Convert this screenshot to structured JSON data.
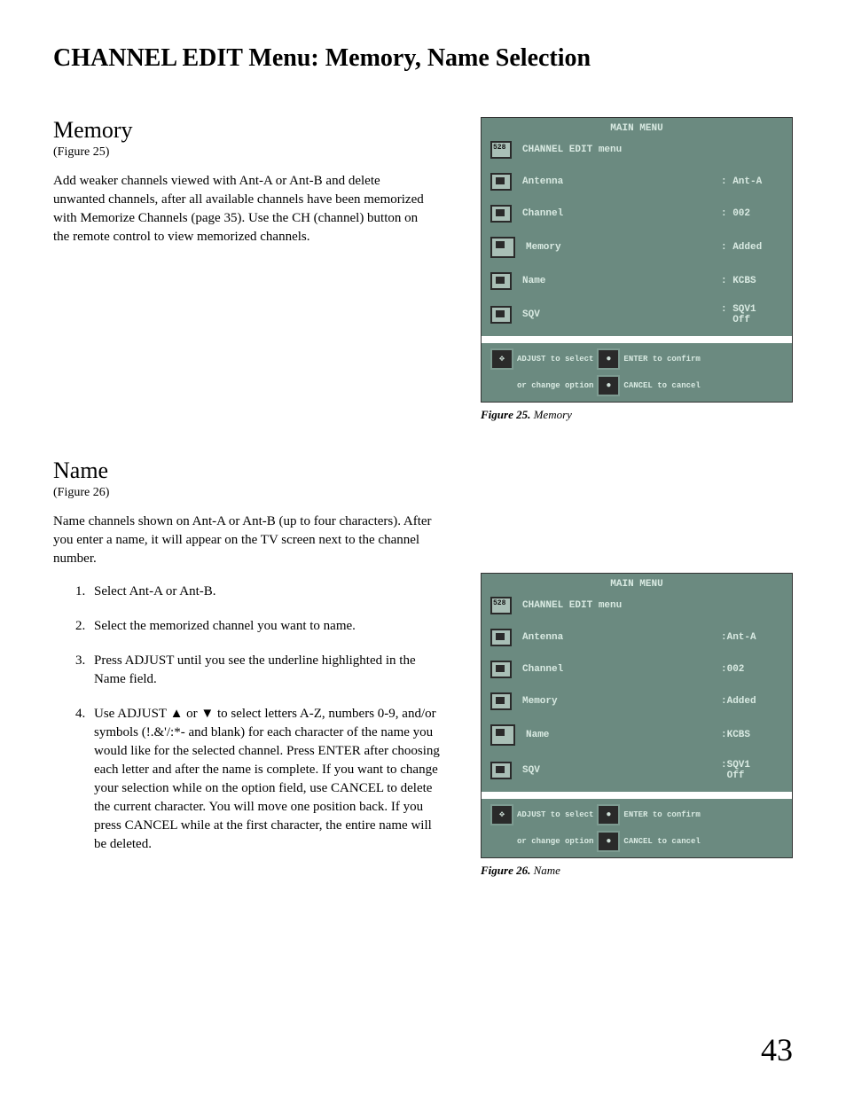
{
  "page": {
    "title": "CHANNEL EDIT Menu: Memory, Name Selection",
    "number": "43"
  },
  "memory": {
    "heading": "Memory",
    "figref": "(Figure 25)",
    "body": "Add weaker channels viewed with Ant-A or Ant-B and delete unwanted channels, after all available channels have been memorized with Memorize Channels (page 35).  Use the CH (channel) button on the remote control to view memorized channels."
  },
  "name": {
    "heading": "Name",
    "figref": "(Figure 26)",
    "body": "Name channels shown on Ant-A or Ant-B (up to four characters).  After you enter a name, it will appear on the TV screen next to the channel number.",
    "steps": [
      "Select Ant-A or Ant-B.",
      "Select the memorized channel you want to name.",
      "Press ADJUST until you see the underline highlighted in the Name field.",
      "Use ADJUST ▲ or ▼ to select letters A-Z, numbers 0-9, and/or symbols (!.&'/:*- and blank) for each character of the name you would like for the selected channel.  Press ENTER after choosing each letter and after the name is complete. If you want to change your selection while on the option field, use CANCEL to delete the current character. You will move one position back.  If you press CANCEL while at the first character, the entire name will be deleted."
    ]
  },
  "osd25": {
    "title": "MAIN MENU",
    "header": "CHANNEL EDIT menu",
    "rows": [
      {
        "label": "Antenna",
        "value": ": Ant-A"
      },
      {
        "label": "Channel",
        "value": ": 002"
      },
      {
        "label": "Memory",
        "value": ": Added",
        "highlight": true
      },
      {
        "label": "Name",
        "value": ": KCBS"
      },
      {
        "label": "SQV",
        "value": ": SQV1\n  Off"
      }
    ],
    "help1a": "ADJUST to select",
    "help1b": "ENTER to confirm",
    "help2a": "or change option",
    "help2b": "CANCEL to cancel",
    "caption_label": "Figure 25.",
    "caption_text": "  Memory"
  },
  "osd26": {
    "title": "MAIN MENU",
    "header": "CHANNEL EDIT menu",
    "rows": [
      {
        "label": "Antenna",
        "value": ":Ant-A"
      },
      {
        "label": "Channel",
        "value": ":002"
      },
      {
        "label": "Memory",
        "value": ":Added"
      },
      {
        "label": "Name",
        "value": ":KCBS",
        "highlight": true
      },
      {
        "label": "SQV",
        "value": ":SQV1\n Off"
      }
    ],
    "help1a": "ADJUST to select",
    "help1b": "ENTER to confirm",
    "help2a": "or change option",
    "help2b": "CANCEL to cancel",
    "caption_label": "Figure 26.",
    "caption_text": "  Name"
  }
}
